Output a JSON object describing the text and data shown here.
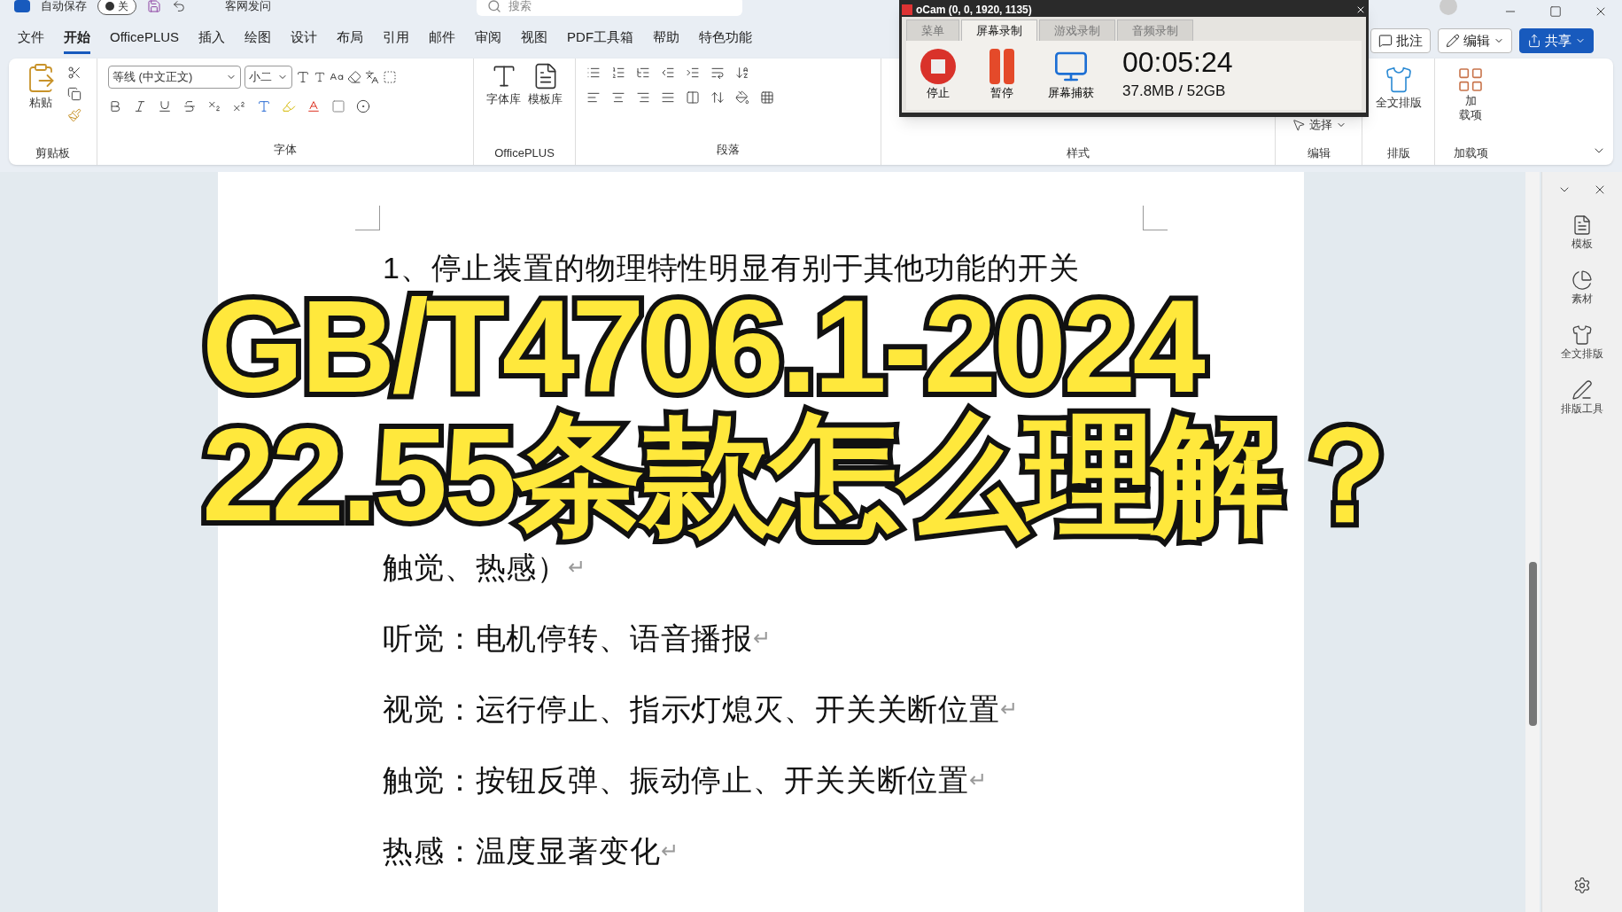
{
  "titlebar": {
    "autosave_label": "自动保存",
    "autosave": {
      "on": false,
      "label": "关"
    },
    "doc_title": "客网发问",
    "search": {
      "placeholder": "搜索"
    }
  },
  "menu_tabs": [
    {
      "label": "文件",
      "selected": false
    },
    {
      "label": "开始",
      "selected": true
    },
    {
      "label": "OfficePLUS",
      "selected": false
    },
    {
      "label": "插入",
      "selected": false
    },
    {
      "label": "绘图",
      "selected": false
    },
    {
      "label": "设计",
      "selected": false
    },
    {
      "label": "布局",
      "selected": false
    },
    {
      "label": "引用",
      "selected": false
    },
    {
      "label": "邮件",
      "selected": false
    },
    {
      "label": "审阅",
      "selected": false
    },
    {
      "label": "视图",
      "selected": false
    },
    {
      "label": "PDF工具箱",
      "selected": false
    },
    {
      "label": "帮助",
      "selected": false
    },
    {
      "label": "特色功能",
      "selected": false
    }
  ],
  "top_buttons": [
    {
      "kind": "comment",
      "label": "批注"
    },
    {
      "kind": "edit",
      "label": "编辑"
    },
    {
      "kind": "share",
      "label": "共享"
    }
  ],
  "ribbon": {
    "clipboard": {
      "paste": "粘贴",
      "group": "剪贴板"
    },
    "font": {
      "name": "等线 (中文正文)",
      "size": "小二",
      "group": "字体"
    },
    "officeplus": {
      "buttons": [
        "字体库",
        "模板库"
      ],
      "group": "OfficePLUS"
    },
    "paragraph": {
      "group": "段落"
    },
    "styles": {
      "group": "样式"
    },
    "editing": {
      "select": "选择",
      "group": "编辑"
    },
    "layout": {
      "button": "全文排版",
      "group": "排版"
    },
    "addins": {
      "button_lines": [
        "加",
        "载项"
      ],
      "group": "加载项"
    }
  },
  "ocam": {
    "title": "oCam (0, 0, 1920, 1135)",
    "tabs": [
      {
        "label": "菜单",
        "selected": false
      },
      {
        "label": "屏幕录制",
        "selected": true
      },
      {
        "label": "游戏录制",
        "selected": false
      },
      {
        "label": "音频录制",
        "selected": false
      }
    ],
    "buttons": [
      {
        "kind": "stop",
        "label": "停止"
      },
      {
        "kind": "pause",
        "label": "暂停"
      },
      {
        "kind": "capture",
        "label": "屏幕捕获"
      }
    ],
    "time": "00:05:24",
    "size": "37.8MB / 52GB"
  },
  "document": {
    "lines": [
      {
        "text": "1、停止装置的物理特性明显有别于其他功能的开关"
      },
      {
        "text": "触觉、热感）",
        "end_mark": "↵"
      },
      {
        "text": "听觉：电机停转、语音播报",
        "end_mark": "↵"
      },
      {
        "text": "视觉：运行停止、指示灯熄灭、开关关断位置",
        "end_mark": "↵"
      },
      {
        "text": "触觉：按钮反弹、振动停止、开关关断位置",
        "end_mark": "↵"
      },
      {
        "text": "热感：温度显著变化",
        "end_mark": "↵"
      }
    ]
  },
  "overlay_title": [
    "GB/T4706.1-2024",
    "22.55条款怎么理解？"
  ],
  "side_pane": [
    {
      "kind": "template",
      "label": "模板"
    },
    {
      "kind": "material",
      "label": "素材"
    },
    {
      "kind": "layout",
      "label": "全文排版"
    },
    {
      "kind": "tools",
      "label": "排版工具"
    }
  ]
}
